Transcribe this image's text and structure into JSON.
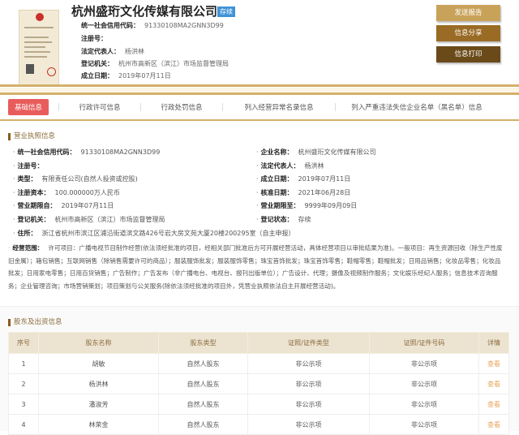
{
  "header": {
    "company": "杭州盛珩文化传媒有限公司",
    "status_badge": "存续",
    "fields": [
      {
        "label": "统一社会信用代码：",
        "value": "91330108MA2GNN3D99"
      },
      {
        "label": "注册号：",
        "value": ""
      },
      {
        "label": "法定代表人：",
        "value": "杨洪林"
      },
      {
        "label": "登记机关：",
        "value": "杭州市高新区（滨江）市场监督管理局"
      },
      {
        "label": "成立日期：",
        "value": "2019年07月11日"
      }
    ],
    "buttons": [
      "发送报告",
      "信息分享",
      "信息打印"
    ],
    "button_colors": [
      "#c9a25a",
      "#9a6b25",
      "#6b4a1a"
    ]
  },
  "tabs": [
    "基础信息",
    "行政许可信息",
    "行政处罚信息",
    "列入经营异常名录信息",
    "列入严重违法失信企业名单（黑名单）信息"
  ],
  "license": {
    "title": "营业执照信息",
    "left": [
      {
        "label": "统一社会信用代码：",
        "value": "91330108MA2GNN3D99"
      },
      {
        "label": "注册号：",
        "value": ""
      },
      {
        "label": "类型：",
        "value": "有限责任公司(自然人投资或控股)"
      },
      {
        "label": "注册资本：",
        "value": "100.000000万人民币"
      },
      {
        "label": "营业期限自：",
        "value": "2019年07月11日"
      },
      {
        "label": "登记机关：",
        "value": "杭州市高新区（滨江）市场监督管理局"
      }
    ],
    "right": [
      {
        "label": "企业名称：",
        "value": "杭州盛珩文化传媒有限公司"
      },
      {
        "label": "法定代表人：",
        "value": "杨洪林"
      },
      {
        "label": "成立日期：",
        "value": "2019年07月11日"
      },
      {
        "label": "核准日期：",
        "value": "2021年06月28日"
      },
      {
        "label": "营业期限至：",
        "value": "9999年09月09日"
      },
      {
        "label": "登记状态：",
        "value": "存续"
      }
    ],
    "address_label": "住所：",
    "address": "浙江省杭州市滨江区浦沿街道滨文路426号岩大房文苑大厦20楼200295室（自主申报）",
    "scope_label": "经营范围：",
    "scope": "许可项目：广播电视节目制作经营(依法须经批准的项目，经相关部门批准后方可开展经营活动，具体经营项目以审批结果为准)。一般项目：再生资源回收（除生产性废旧金属）；箱包销售；互联网销售（除销售需要许可的商品）；服装服饰批发；服装服饰零售；珠宝首饰批发；珠宝首饰零售；鞋帽零售；鞋帽批发；日用品销售；化妆品零售；化妆品批发；日用家电零售；日用百货销售；广告制作；广告发布（非广播电台、电视台、报刊出版单位）；广告设计、代理；摄像及视频制作服务；文化娱乐经纪人服务；信息技术咨询服务；企业管理咨询；市场营销策划；项目策划与公关服务(除依法须经批准的项目外，凭营业执照依法自主开展经营活动)。"
  },
  "shareholders": {
    "title": "股东及出资信息",
    "columns": [
      "序号",
      "股东名称",
      "股东类型",
      "证照/证件类型",
      "证照/证件号码",
      "详情"
    ],
    "rows": [
      [
        "1",
        "胡敏",
        "自然人股东",
        "非公示项",
        "非公示项",
        "查看"
      ],
      [
        "2",
        "杨洪林",
        "自然人股东",
        "非公示项",
        "非公示项",
        "查看"
      ],
      [
        "3",
        "潘淑芳",
        "自然人股东",
        "非公示项",
        "非公示项",
        "查看"
      ],
      [
        "4",
        "林荣金",
        "自然人股东",
        "非公示项",
        "非公示项",
        "查看"
      ]
    ]
  }
}
